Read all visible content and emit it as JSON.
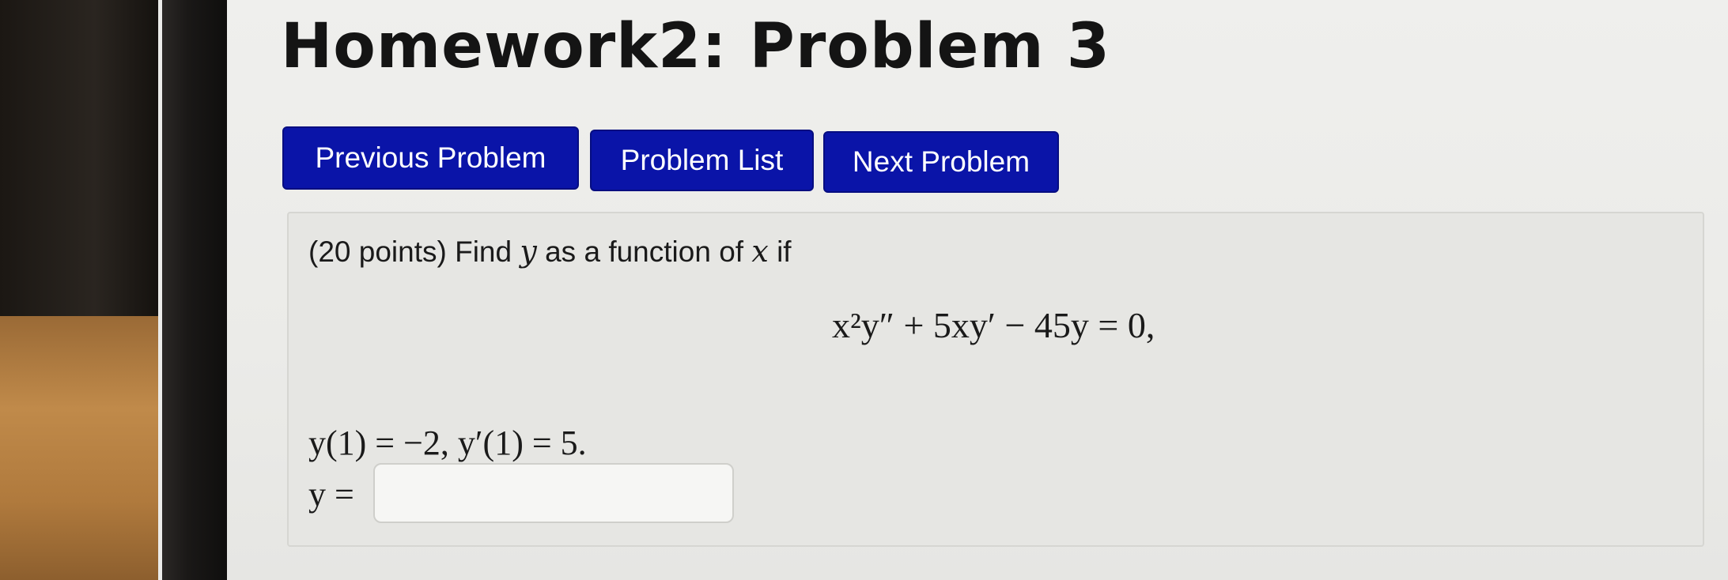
{
  "page": {
    "title": "Homework2: Problem 3"
  },
  "nav": {
    "previous_label": "Previous Problem",
    "list_label": "Problem List",
    "next_label": "Next Problem",
    "button_color": "#0a14a8"
  },
  "problem": {
    "prompt_prefix": "(20 points) Find",
    "var_y": "y",
    "prompt_middle": "as a function of",
    "var_x": "x",
    "prompt_suffix": "if",
    "equation": "x²y″ + 5xy′ − 45y = 0,",
    "conditions": "y(1) = −2,  y′(1) = 5.",
    "answer_label": "y =",
    "answer_value": ""
  }
}
